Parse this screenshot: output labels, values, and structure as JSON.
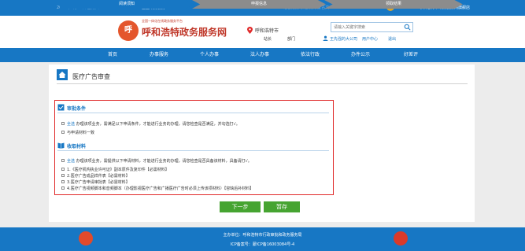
{
  "topbar": {
    "left_text": "2022年1月13日  星期四",
    "app_label": "全国政务服务APP",
    "middle_text": "语音播报  长者模式  蒙古文",
    "right_text": "呼和浩特市政务服务网旗舰店"
  },
  "header": {
    "site_subtitle": "全国一体化在线政务服务平台",
    "site_name_prefix": "呼和浩特",
    "site_name": "政务服务网",
    "logo_text": "呼",
    "city": "呼和浩特市",
    "search_placeholder": "请输入关键字搜索",
    "link_service": "站长",
    "link_dept": "部门",
    "user": "王先强的大公司",
    "user_center": "用户中心",
    "logout": "退出"
  },
  "nav": [
    "首页",
    "办事服务",
    "个人办事",
    "法人办事",
    "依法行政",
    "办件公示",
    "好差评"
  ],
  "page": {
    "title": "医疗广告审查"
  },
  "steps": [
    {
      "label": "阅读须知",
      "state": "active"
    },
    {
      "label": "申报信息",
      "state": "pending"
    },
    {
      "label": "领取结果",
      "state": "pending"
    }
  ],
  "conditions": {
    "title": "审批条件",
    "lines": [
      {
        "prefix": "全选",
        "text": "办理该项业务，需满足以下申请条件，才能进行业务的办理，请您检查是否满足，并勾选打√。"
      },
      {
        "prefix": "",
        "text": "与申请材料一致"
      }
    ]
  },
  "materials": {
    "title": "收取材料",
    "intro_prefix": "全选",
    "intro": "办理该项业务，需提供以下申请材料，才能进行业务的办理，请您检查是否具备该材料，具备请打√。",
    "items": [
      "1.《医疗机构执业许可证》副本原件及复印件【必需材料】",
      "2.医疗广告成品样件表【必需材料】",
      "3.医疗广告申请审批表【必需材料】",
      "4.医疗广告视频脚本和音频脚本（办理影视医疗广告和广播医疗广告时必须上传该项材料）【容缺后补材料】"
    ]
  },
  "buttons": {
    "next": "下一步",
    "save": "暂存"
  },
  "footer": {
    "sponsor": "主办单位：呼和浩特市行政审批和政务服务局",
    "icp": "ICP备案号：蒙ICP备16003084号-4"
  },
  "colors": {
    "primary": "#1777c4",
    "button": "#46a431",
    "highlight": "#e02a2a"
  }
}
